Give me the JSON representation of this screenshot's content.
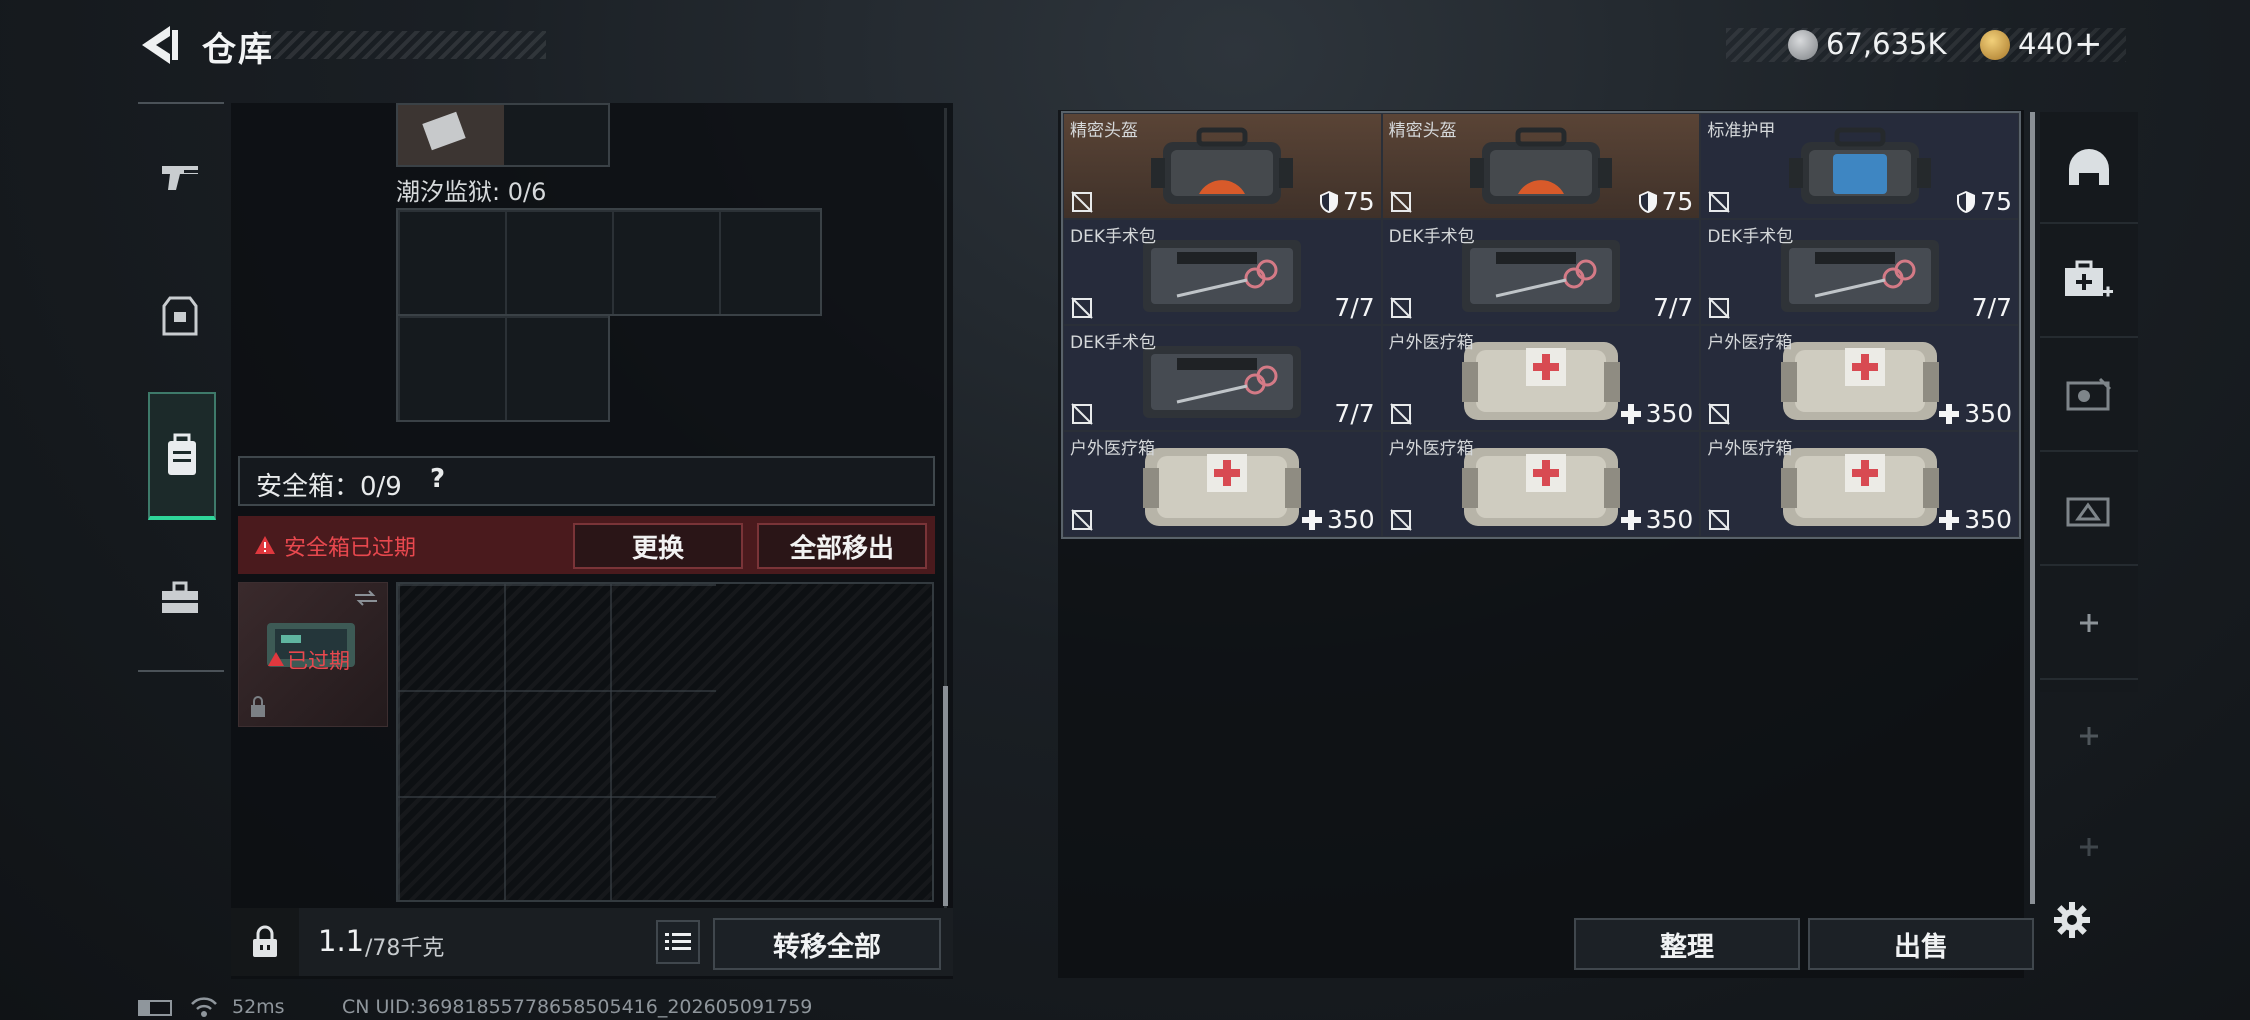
{
  "header": {
    "title": "仓库",
    "silver": "67,635K",
    "gold": "440",
    "gold_add": "+"
  },
  "nav": {
    "items": [
      "weapon-icon",
      "armor-icon",
      "backpack-icon",
      "toolbox-icon"
    ]
  },
  "left": {
    "container_label": "潮汐监狱: 0/6",
    "safebox_label": "安全箱：0/9",
    "safebox_help": "?",
    "expired_notice": "安全箱已过期",
    "replace_btn": "更换",
    "remove_all_btn": "全部移出",
    "safebox_item_tag": "已过期",
    "weight_value": "1.1",
    "weight_max": "/78千克",
    "transfer_all_btn": "转移全部"
  },
  "items": [
    {
      "name": "精密头盔",
      "value": "75",
      "kind": "shield",
      "art": "bag-orange",
      "bg": "brown"
    },
    {
      "name": "精密头盔",
      "value": "75",
      "kind": "shield",
      "art": "bag-orange",
      "bg": "brown"
    },
    {
      "name": "标准护甲",
      "value": "75",
      "kind": "shield",
      "art": "bag-blue",
      "bg": "navy"
    },
    {
      "name": "DEK手术包",
      "value": "7/7",
      "kind": "plain",
      "art": "surgical",
      "bg": "navy"
    },
    {
      "name": "DEK手术包",
      "value": "7/7",
      "kind": "plain",
      "art": "surgical",
      "bg": "navy"
    },
    {
      "name": "DEK手术包",
      "value": "7/7",
      "kind": "plain",
      "art": "surgical",
      "bg": "navy"
    },
    {
      "name": "DEK手术包",
      "value": "7/7",
      "kind": "plain",
      "art": "surgical",
      "bg": "navy"
    },
    {
      "name": "户外医疗箱",
      "value": "350",
      "kind": "plus",
      "art": "medkit",
      "bg": "navy"
    },
    {
      "name": "户外医疗箱",
      "value": "350",
      "kind": "plus",
      "art": "medkit",
      "bg": "navy"
    },
    {
      "name": "户外医疗箱",
      "value": "350",
      "kind": "plus",
      "art": "medkit",
      "bg": "navy"
    },
    {
      "name": "户外医疗箱",
      "value": "350",
      "kind": "plus",
      "art": "medkit",
      "bg": "navy"
    },
    {
      "name": "户外医疗箱",
      "value": "350",
      "kind": "plus",
      "art": "medkit",
      "bg": "navy"
    }
  ],
  "right": {
    "sort_btn": "整理",
    "sell_btn": "出售"
  },
  "side_tabs": [
    "helmet-icon",
    "medkit-add-icon",
    "ammo-icon",
    "tool-icon",
    "add-icon",
    "add-icon",
    "add-icon"
  ],
  "footer": {
    "ping": "52ms",
    "uid": "CN UID:36981855778658505416_202605091759"
  },
  "colors": {
    "accent": "#2fd69a",
    "danger": "#e0383e",
    "expired_bg": "#4a1a1d",
    "item_navy": "#262b3b",
    "item_brown": "#5a4436"
  }
}
